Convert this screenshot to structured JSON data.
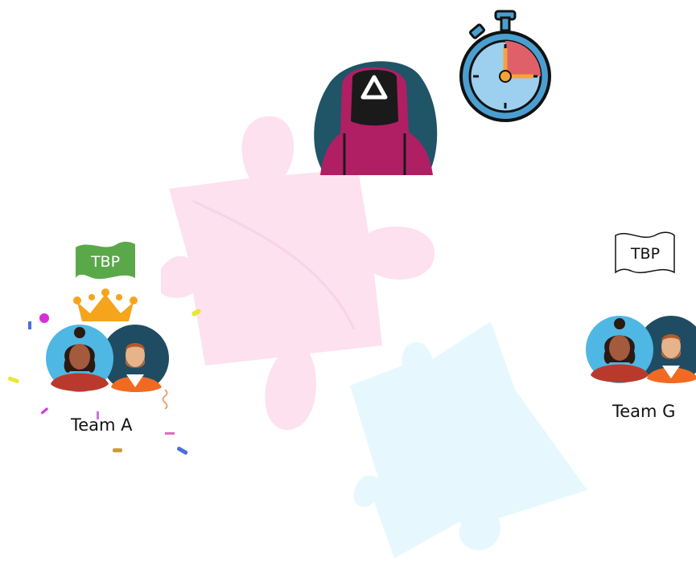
{
  "teams": [
    {
      "name": "Team A",
      "flag_label": "TBP",
      "flag_color": "#5aa84a",
      "leader": true
    },
    {
      "name": "Team G",
      "flag_label": "TBP",
      "flag_color": "#ffffff",
      "leader": false
    }
  ],
  "icons": {
    "guard": "masked-guard-icon",
    "timer": "stopwatch-icon",
    "crown": "crown-icon"
  },
  "colors": {
    "puzzle_pink": "#fde1ef",
    "puzzle_blue": "#e6f8fd",
    "guard_suit": "#b01f63",
    "guard_hair": "#1f5566",
    "timer_face": "#9cd0ee",
    "timer_elapsed": "#e0606a",
    "crown": "#f4a51c"
  }
}
